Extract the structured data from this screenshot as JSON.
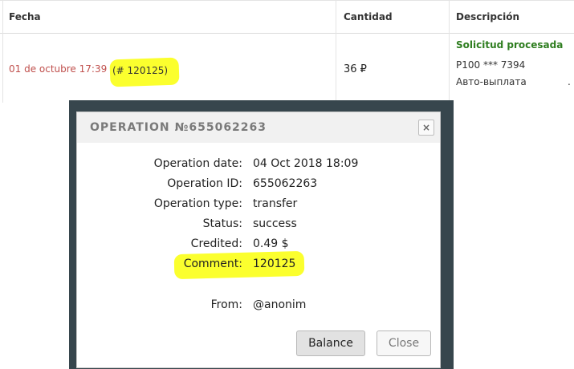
{
  "table": {
    "headers": {
      "fecha": "Fecha",
      "cantidad": "Cantidad",
      "descripcion": "Descripción"
    },
    "row": {
      "date": "01 de octubre 17:39",
      "reference": "(# 120125)",
      "amount": "36 ₽",
      "status": "Solicitud procesada",
      "account": "P100 *** 7394",
      "description": "Авто-выплата",
      "trailing": "."
    }
  },
  "dialog": {
    "title": "OPERATION №655062263",
    "close_icon": "×",
    "fields": [
      {
        "label": "Operation date:",
        "value": "04 Oct 2018 18:09"
      },
      {
        "label": "Operation ID:",
        "value": "655062263"
      },
      {
        "label": "Operation type:",
        "value": "transfer"
      },
      {
        "label": "Status:",
        "value": "success"
      },
      {
        "label": "Credited:",
        "value": "0.49 $"
      },
      {
        "label": "Comment:",
        "value": "120125"
      },
      {
        "label": "From:",
        "value": "@anonim"
      }
    ],
    "buttons": {
      "balance": "Balance",
      "close": "Close"
    }
  },
  "colors": {
    "highlight": "#fbff2e",
    "date_text": "#c0504d",
    "status_text": "#2e7d1f",
    "backdrop": "#37464d"
  }
}
